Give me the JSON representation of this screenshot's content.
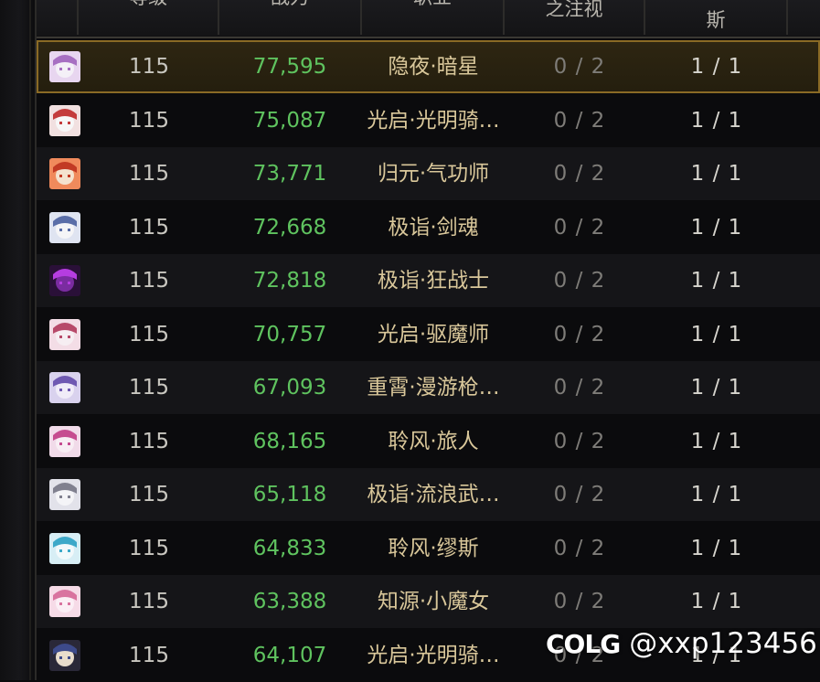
{
  "header": {
    "col_level": "等级",
    "col_power": "战力",
    "col_job": "职业",
    "col_a": "之注视",
    "col_b": "斯"
  },
  "rows": [
    {
      "avatar": "berserker-female-portrait-icon",
      "level": "115",
      "power": "77,595",
      "job": "隐夜·暗星",
      "a": "0 / 2",
      "b": "1 / 1",
      "selected": true
    },
    {
      "avatar": "knight-portrait-icon",
      "level": "115",
      "power": "75,087",
      "job": "光启·光明骑…",
      "a": "0 / 2",
      "b": "1 / 1"
    },
    {
      "avatar": "fighter-portrait-icon",
      "level": "115",
      "power": "73,771",
      "job": "归元·气功师",
      "a": "0 / 2",
      "b": "1 / 1"
    },
    {
      "avatar": "slayer-portrait-icon",
      "level": "115",
      "power": "72,668",
      "job": "极诣·剑魂",
      "a": "0 / 2",
      "b": "1 / 1"
    },
    {
      "avatar": "berserker-weapon-icon",
      "level": "115",
      "power": "72,818",
      "job": "极诣·狂战士",
      "a": "0 / 2",
      "b": "1 / 1"
    },
    {
      "avatar": "exorcist-portrait-icon",
      "level": "115",
      "power": "70,757",
      "job": "光启·驱魔师",
      "a": "0 / 2",
      "b": "1 / 1"
    },
    {
      "avatar": "gunner-portrait-icon",
      "level": "115",
      "power": "67,093",
      "job": "重霄·漫游枪…",
      "a": "0 / 2",
      "b": "1 / 1"
    },
    {
      "avatar": "traveler-portrait-icon",
      "level": "115",
      "power": "68,165",
      "job": "聆风·旅人",
      "a": "0 / 2",
      "b": "1 / 1"
    },
    {
      "avatar": "vagabond-portrait-icon",
      "level": "115",
      "power": "65,118",
      "job": "极诣·流浪武…",
      "a": "0 / 2",
      "b": "1 / 1"
    },
    {
      "avatar": "muse-portrait-icon",
      "level": "115",
      "power": "64,833",
      "job": "聆风·缪斯",
      "a": "0 / 2",
      "b": "1 / 1"
    },
    {
      "avatar": "witch-portrait-icon",
      "level": "115",
      "power": "63,388",
      "job": "知源·小魔女",
      "a": "0 / 2",
      "b": "1 / 1"
    },
    {
      "avatar": "paladin-portrait-icon",
      "level": "115",
      "power": "64,107",
      "job": "光启·光明骑…",
      "a": "0 / 2",
      "b": "1 / 1"
    }
  ],
  "watermark": {
    "logo": "COLG",
    "handle": "@xxp123456"
  },
  "colors": {
    "power": "#5fc35f",
    "job": "#d9c79a",
    "selected_border": "#8a6a25"
  }
}
